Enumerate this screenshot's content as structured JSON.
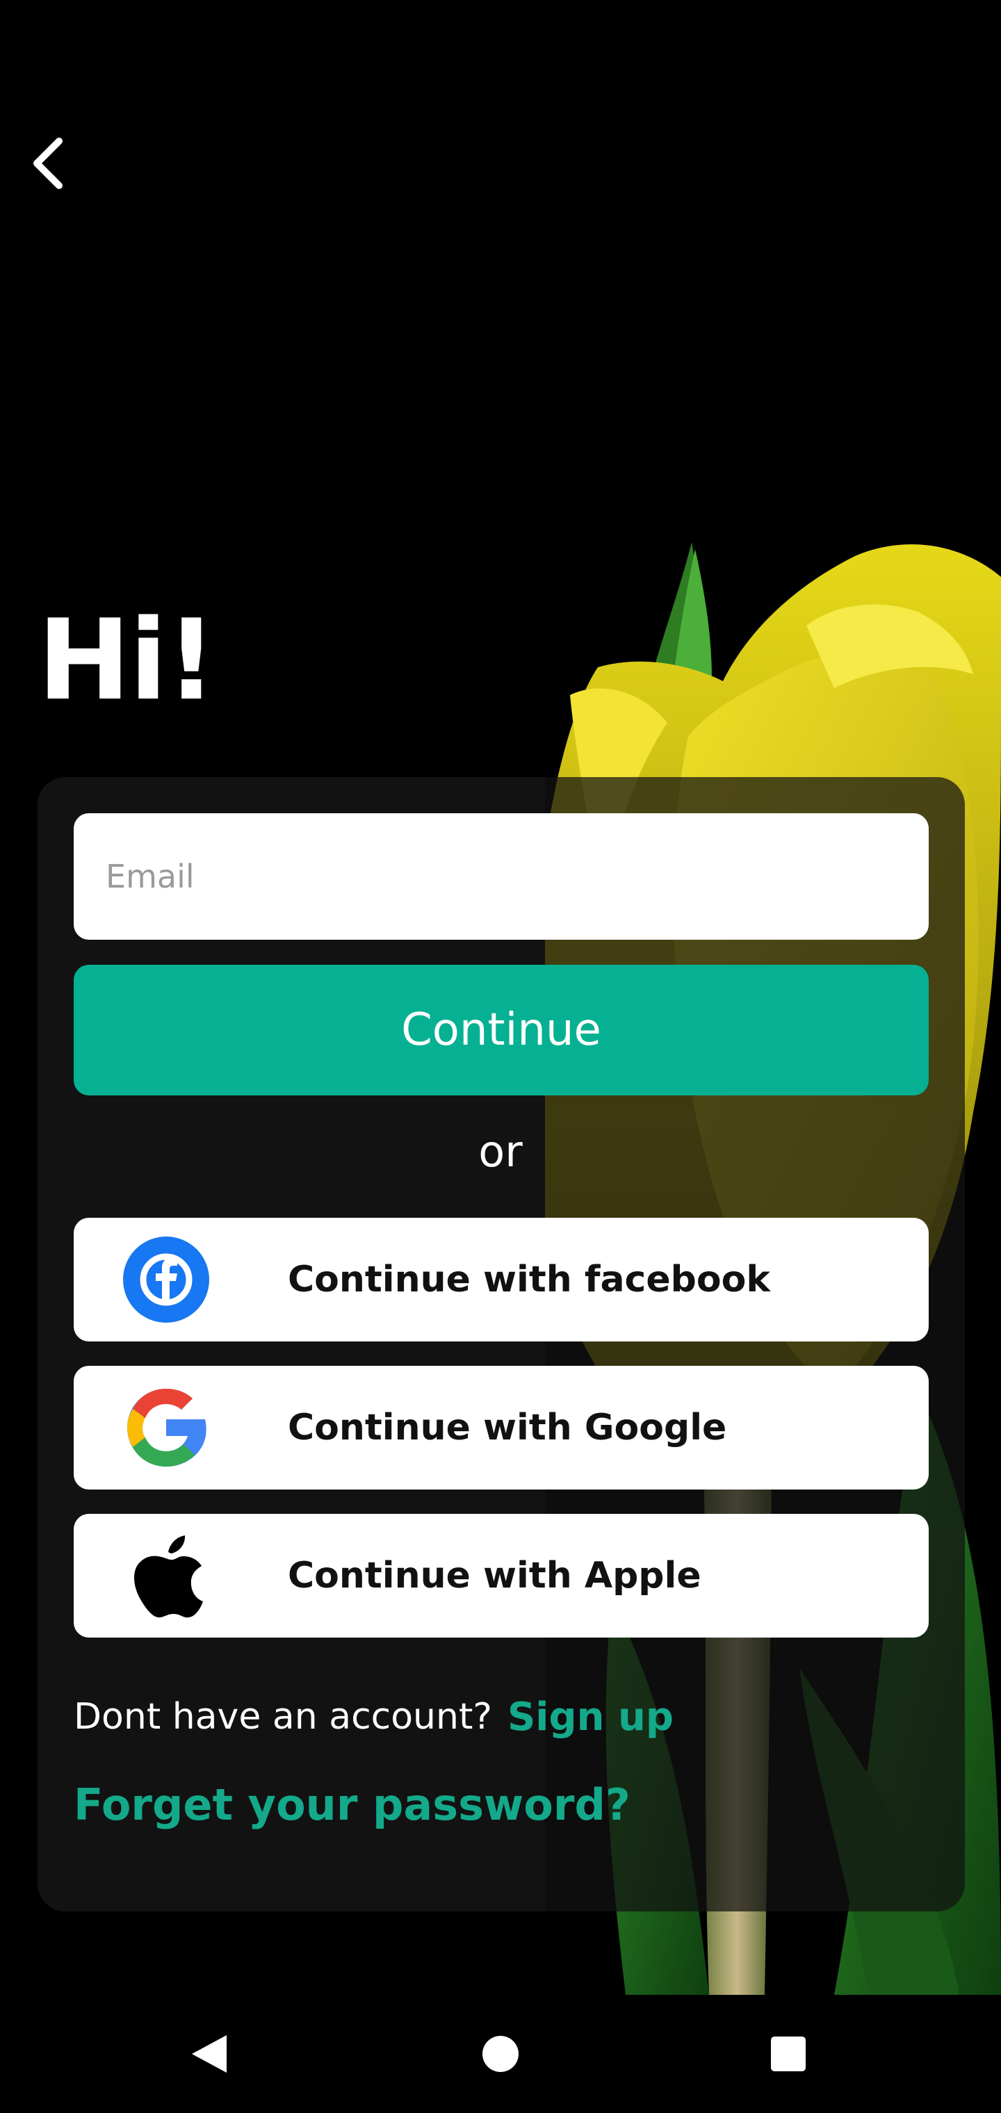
{
  "header": {
    "greeting": "Hi!"
  },
  "form": {
    "email_placeholder": "Email",
    "email_value": "",
    "continue_label": "Continue",
    "divider_label": "or"
  },
  "social": [
    {
      "label": "Continue with facebook",
      "icon": "facebook-icon"
    },
    {
      "label": "Continue with Google",
      "icon": "google-icon"
    },
    {
      "label": "Continue with Apple",
      "icon": "apple-icon"
    }
  ],
  "footer": {
    "signup_prompt": "Dont have an account?",
    "signup_link": "Sign up",
    "forgot_link": "Forget your password?"
  },
  "colors": {
    "accent": "#05b192",
    "link": "#13a98a",
    "card": "#121212",
    "background": "#000000",
    "facebook": "#1877f2"
  },
  "nav_icons": [
    "back-triangle-icon",
    "home-circle-icon",
    "recents-square-icon"
  ]
}
